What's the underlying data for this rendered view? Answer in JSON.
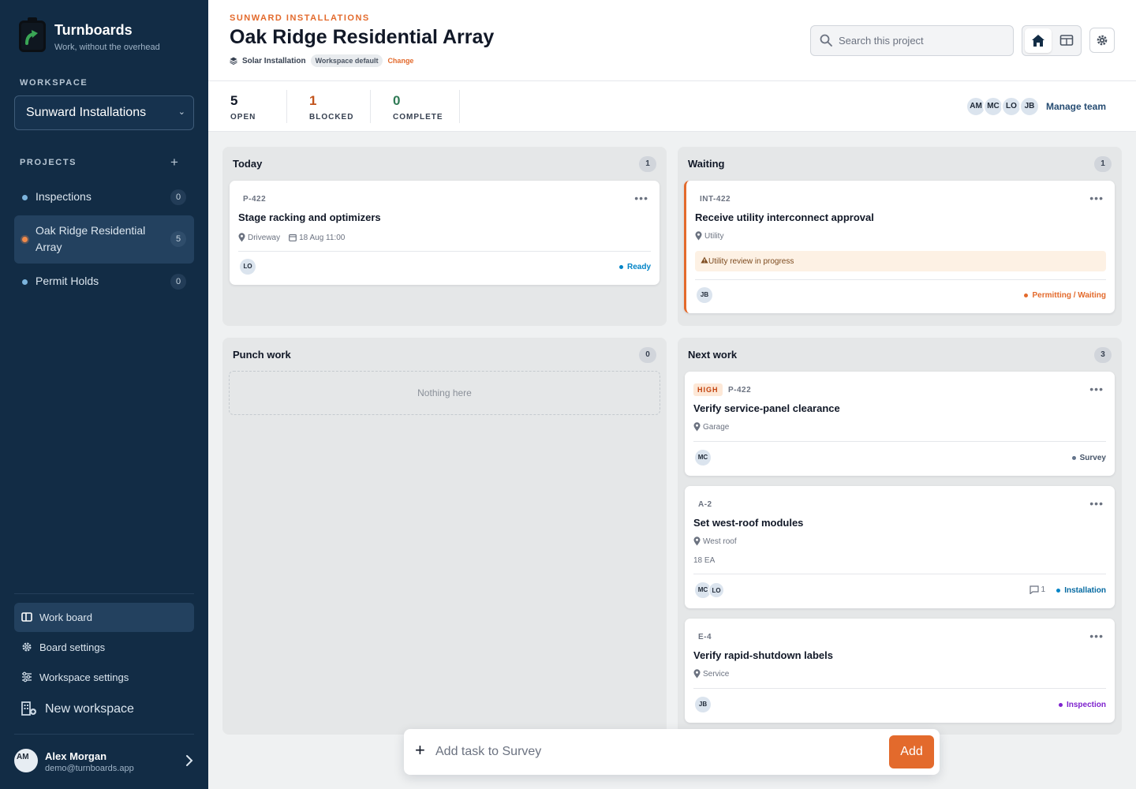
{
  "app": {
    "name": "Turnboards",
    "tagline": "Work, without the overhead"
  },
  "sidebar": {
    "workspace_label": "WORKSPACE",
    "workspace_value": "Sunward Installations",
    "projects_label": "PROJECTS",
    "projects": [
      {
        "name": "Inspections",
        "count": "0",
        "dot_color": "#7cb4dd"
      },
      {
        "name": "Oak Ridge Residential Array",
        "count": "5",
        "dot_color": "#f08a4b"
      },
      {
        "name": "Permit Holds",
        "count": "0",
        "dot_color": "#7cb4dd"
      }
    ],
    "nav": [
      {
        "label": "Work board",
        "icon": "board-icon"
      },
      {
        "label": "Board settings",
        "icon": "gear-icon"
      },
      {
        "label": "Workspace settings",
        "icon": "sliders-icon"
      },
      {
        "label": "New workspace",
        "icon": "building-plus-icon"
      }
    ],
    "user": {
      "initials": "AM",
      "name": "Alex Morgan",
      "email": "demo@turnboards.app"
    }
  },
  "header": {
    "eyebrow": "SUNWARD INSTALLATIONS",
    "title": "Oak Ridge Residential Array",
    "type_label": "Solar Installation",
    "type_badge": "Workspace default",
    "change_label": "Change",
    "search_placeholder": "Search this project"
  },
  "stats": [
    {
      "value": "5",
      "label": "OPEN",
      "color": "#111827"
    },
    {
      "value": "1",
      "label": "BLOCKED",
      "color": "#c2541c"
    },
    {
      "value": "0",
      "label": "COMPLETE",
      "color": "#2f7a55"
    }
  ],
  "team": {
    "members": [
      "AM",
      "MC",
      "LO",
      "JB"
    ],
    "manage_label": "Manage team"
  },
  "columns": {
    "today": {
      "title": "Today",
      "count": "1",
      "cards": [
        {
          "id": "P-422",
          "title": "Stage racking and optimizers",
          "location": "Driveway",
          "date": "18 Aug 11:00",
          "assignees": [
            "LO"
          ],
          "status": "Ready",
          "status_color": "#0284c7"
        }
      ]
    },
    "waiting": {
      "title": "Waiting",
      "count": "1",
      "cards": [
        {
          "id": "INT-422",
          "title": "Receive utility interconnect approval",
          "location": "Utility",
          "warning": "Utility review in progress",
          "assignees": [
            "JB"
          ],
          "status": "Permitting / Waiting",
          "status_color": "#e36a2c"
        }
      ]
    },
    "punch": {
      "title": "Punch work",
      "count": "0",
      "empty_text": "Nothing here"
    },
    "next": {
      "title": "Next work",
      "count": "3",
      "cards": [
        {
          "priority": "HIGH",
          "id": "P-422",
          "title": "Verify service-panel clearance",
          "location": "Garage",
          "assignees": [
            "MC"
          ],
          "status": "Survey",
          "status_color": "#64748b"
        },
        {
          "id": "A-2",
          "title": "Set west-roof modules",
          "location": "West roof",
          "quantity": "18 EA",
          "assignees": [
            "MC",
            "LO"
          ],
          "comments": "1",
          "status": "Installation",
          "status_color": "#0369a1"
        },
        {
          "id": "E-4",
          "title": "Verify rapid-shutdown labels",
          "location": "Service",
          "assignees": [
            "JB"
          ],
          "status": "Inspection",
          "status_color": "#7e22ce"
        }
      ]
    }
  },
  "add_task": {
    "placeholder": "Add task to Survey",
    "button": "Add"
  }
}
